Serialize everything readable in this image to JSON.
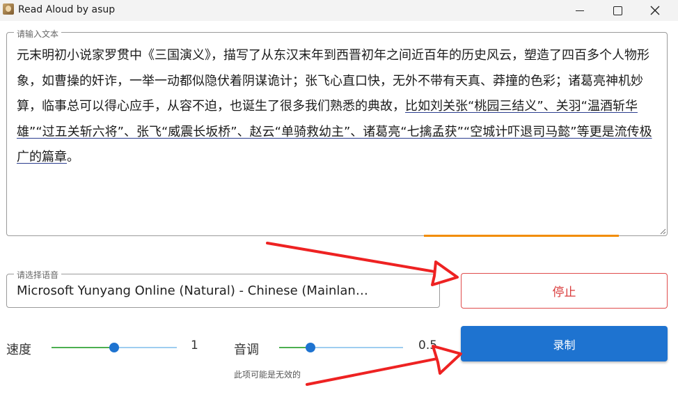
{
  "window": {
    "title": "Read Aloud by asup",
    "icon": "app-icon"
  },
  "text_input": {
    "legend": "请输入文本",
    "text_plain": "元末明初小说家罗贯中《三国演义》，描写了从东汉末年到西晋初年之间近百年的历史风云，塑造了四百多个人物形象，如曹操的奸诈，一举一动都似隐伏着阴谋诡计；张飞心直口快，无外不带有天真、莽撞的色彩；诸葛亮神机妙算，临事总可以得心应手，从容不迫，也诞生了很多我们熟悉的典故，",
    "text_highlighted": "比如刘关张“桃园三结义”、关羽“温酒斩华雄”“过五关斩六将”、张飞“威震长坂桥”、赵云“单骑救幼主”、诸葛亮“七擒孟获”“空城计吓退司马懿”等更是流传极广的篇章",
    "text_end": "。",
    "progress_color": "#f28c00"
  },
  "voice": {
    "legend": "请选择语音",
    "selected": "Microsoft Yunyang Online (Natural) - Chinese (Mainlan…"
  },
  "buttons": {
    "stop_label": "停止",
    "record_label": "录制",
    "stop_color": "#d93a3a",
    "record_color": "#1e73d0"
  },
  "speed": {
    "label": "速度",
    "value": "1",
    "level": 0.5
  },
  "pitch": {
    "label": "音调",
    "value": "0.5",
    "level": 0.25,
    "hint": "此项可能是无效的"
  },
  "annotation_color": "#ee2222"
}
